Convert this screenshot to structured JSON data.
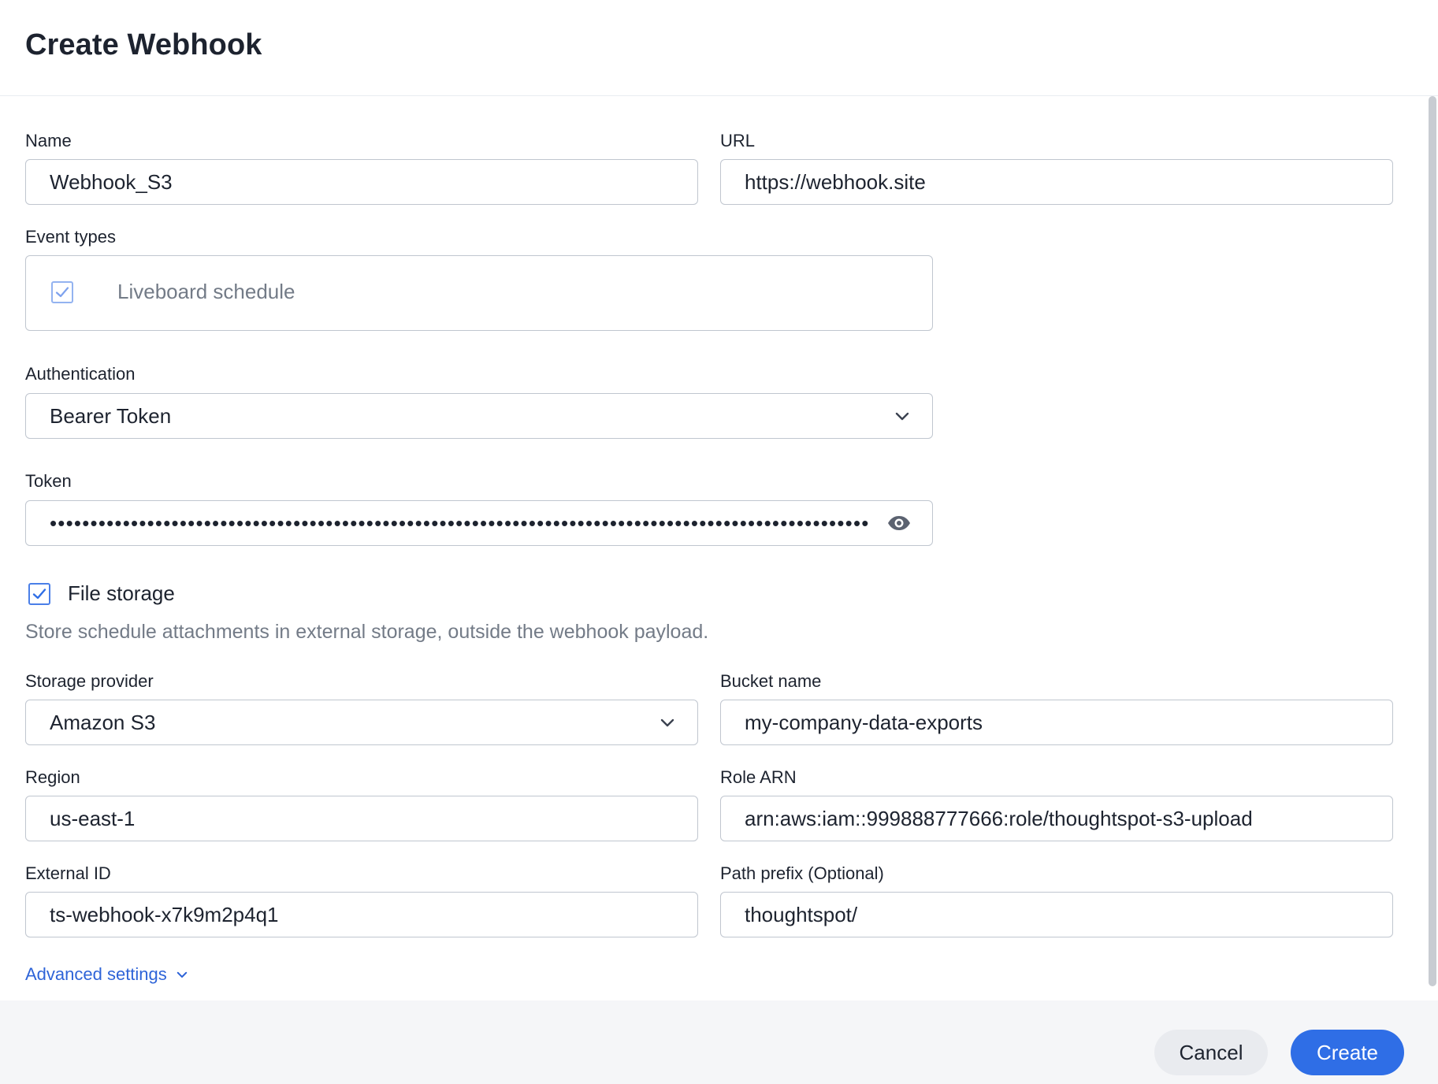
{
  "dialog": {
    "title": "Create Webhook"
  },
  "form": {
    "name": {
      "label": "Name",
      "value": "Webhook_S3"
    },
    "url": {
      "label": "URL",
      "value": "https://webhook.site"
    },
    "event_types": {
      "label": "Event types",
      "options": [
        {
          "label": "Liveboard schedule",
          "checked": true
        }
      ]
    },
    "authentication": {
      "label": "Authentication",
      "value": "Bearer Token"
    },
    "token": {
      "label": "Token",
      "value": "•••••••••••••••••••••••••••••••••••••••••••••••••••••••••••••••••••••••••••••••••••••••••••••••••••••",
      "icon": "eye-icon"
    },
    "file_storage": {
      "label": "File storage",
      "checked": true,
      "description": "Store schedule attachments in external storage, outside the webhook payload."
    },
    "storage_provider": {
      "label": "Storage provider",
      "value": "Amazon S3"
    },
    "bucket_name": {
      "label": "Bucket name",
      "value": "my-company-data-exports"
    },
    "region": {
      "label": "Region",
      "value": "us-east-1"
    },
    "role_arn": {
      "label": "Role ARN",
      "value": "arn:aws:iam::999888777666:role/thoughtspot-s3-upload"
    },
    "external_id": {
      "label": "External ID",
      "value": "ts-webhook-x7k9m2p4q1"
    },
    "path_prefix": {
      "label": "Path prefix (Optional)",
      "value": "thoughtspot/"
    },
    "advanced_settings": {
      "label": "Advanced settings"
    }
  },
  "footer": {
    "cancel_label": "Cancel",
    "create_label": "Create"
  },
  "colors": {
    "accent": "#2f6ee6",
    "link": "#2e64d8",
    "border": "#c0c6cf",
    "muted_text": "#737b87"
  }
}
